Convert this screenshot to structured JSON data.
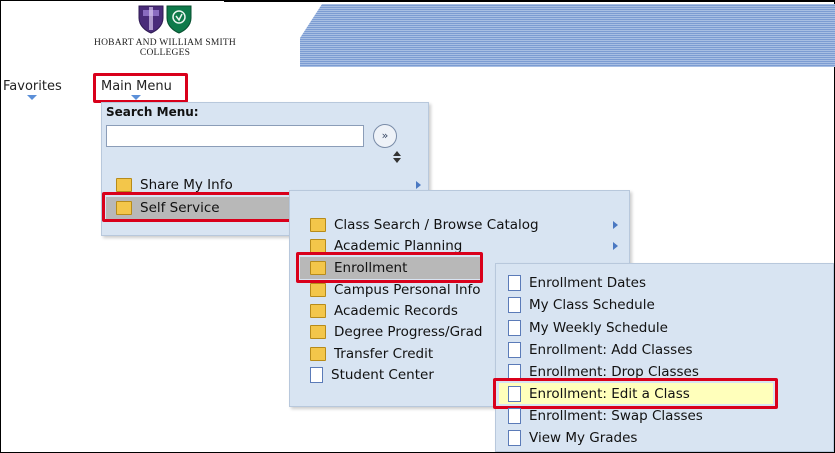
{
  "header": {
    "school_line1": "HOBART AND WILLIAM SMITH",
    "school_line2": "COLLEGES"
  },
  "navbar": {
    "favorites": "Favorites",
    "main_menu": "Main Menu"
  },
  "search": {
    "label": "Search Menu:",
    "value": "",
    "go_glyph": "»"
  },
  "main_menu_items": [
    {
      "label": "Share My Info",
      "icon": "folder-icon"
    },
    {
      "label": "Self Service",
      "icon": "folder-icon"
    }
  ],
  "self_service_items": [
    {
      "label": "Class Search / Browse Catalog",
      "icon": "folder-icon"
    },
    {
      "label": "Academic Planning",
      "icon": "folder-icon"
    },
    {
      "label": "Enrollment",
      "icon": "folder-icon"
    },
    {
      "label": "Campus Personal Info",
      "icon": "folder-icon"
    },
    {
      "label": "Academic Records",
      "icon": "folder-icon"
    },
    {
      "label": "Degree Progress/Grad",
      "icon": "folder-icon"
    },
    {
      "label": "Transfer Credit",
      "icon": "folder-icon"
    },
    {
      "label": "Student Center",
      "icon": "document-icon"
    }
  ],
  "enrollment_items": [
    {
      "label": "Enrollment Dates",
      "icon": "document-icon"
    },
    {
      "label": "My Class Schedule",
      "icon": "document-icon"
    },
    {
      "label": "My Weekly Schedule",
      "icon": "document-icon"
    },
    {
      "label": "Enrollment: Add Classes",
      "icon": "document-icon"
    },
    {
      "label": "Enrollment: Drop Classes",
      "icon": "document-icon"
    },
    {
      "label": "Enrollment: Edit a Class",
      "icon": "document-icon"
    },
    {
      "label": "Enrollment: Swap Classes",
      "icon": "document-icon"
    },
    {
      "label": "View My Grades",
      "icon": "document-icon"
    }
  ],
  "colors": {
    "highlight_border": "#d9001b",
    "panel_bg": "#d8e4f2",
    "selected_row": "#b8b8b8",
    "active_row": "#ffffbb"
  }
}
